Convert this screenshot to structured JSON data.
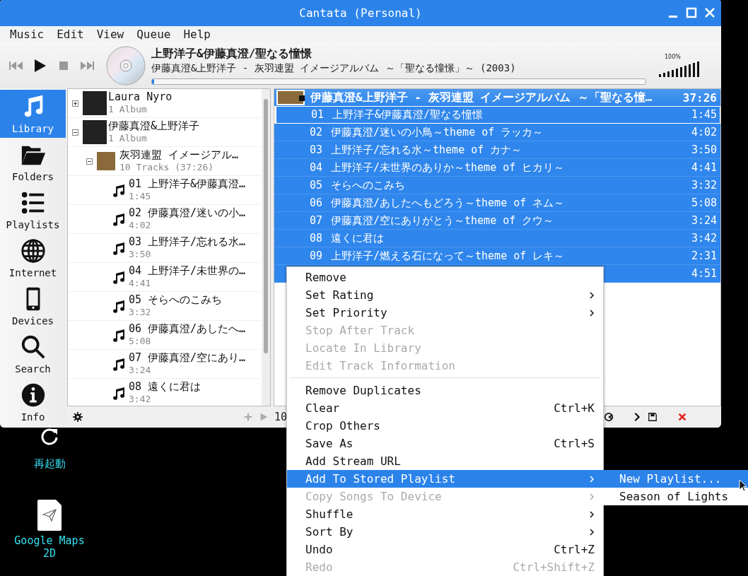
{
  "window": {
    "title": "Cantata (Personal)"
  },
  "menu_bar": [
    "Music",
    "Edit",
    "View",
    "Queue",
    "Help"
  ],
  "now_playing": {
    "title": "上野洋子&伊藤真澄/聖なる憧憬",
    "subtitle": "伊藤真澄&上野洋子 - 灰羽連盟 イメージアルバム ～「聖なる憧憬」～ (2003)",
    "level": 0.005
  },
  "volume": {
    "label": "100%",
    "level": 1
  },
  "sidebar": {
    "items": [
      {
        "label": "Library",
        "kind": "library",
        "selected": true
      },
      {
        "label": "Folders",
        "kind": "folders",
        "selected": false
      },
      {
        "label": "Playlists",
        "kind": "playlists",
        "selected": false
      },
      {
        "label": "Internet",
        "kind": "internet",
        "selected": false
      },
      {
        "label": "Devices",
        "kind": "devices",
        "selected": false
      },
      {
        "label": "Search",
        "kind": "search",
        "selected": false
      },
      {
        "label": "Info",
        "kind": "info",
        "selected": false
      }
    ]
  },
  "library": {
    "items": [
      {
        "kind": "artist",
        "title": "Laura Nyro",
        "detail": "1 Album",
        "expanded": false
      },
      {
        "kind": "artist",
        "title": "伊藤真澄&上野洋子",
        "detail": "1 Album",
        "expanded": true,
        "children": [
          {
            "kind": "album",
            "title": "灰羽連盟 イメージアル…",
            "detail": "10 Tracks (37:26)",
            "expanded": true,
            "children": [
              {
                "kind": "track",
                "title": "01 上野洋子&伊藤真澄…",
                "detail": "1:45"
              },
              {
                "kind": "track",
                "title": "02 伊藤真澄/迷いの小…",
                "detail": "4:02"
              },
              {
                "kind": "track",
                "title": "03 上野洋子/忘れる水…",
                "detail": "3:50"
              },
              {
                "kind": "track",
                "title": "04 上野洋子/未世界の…",
                "detail": "4:41"
              },
              {
                "kind": "track",
                "title": "05 そらへのこみち",
                "detail": "3:32"
              },
              {
                "kind": "track",
                "title": "06 伊藤真澄/あしたへ…",
                "detail": "5:08"
              },
              {
                "kind": "track",
                "title": "07 伊藤真澄/空にあり…",
                "detail": "3:24"
              },
              {
                "kind": "track",
                "title": "08 遠くに君は",
                "detail": "3:42"
              }
            ]
          }
        ]
      }
    ]
  },
  "playlist": {
    "header": {
      "title": "伊藤真澄&上野洋子 - 灰羽連盟 イメージアルバム ～「聖なる憧…",
      "duration": "37:26"
    },
    "rows": [
      {
        "number": "01",
        "title": "上野洋子&伊藤真澄/聖なる憧憬",
        "duration": "1:45",
        "selected": true,
        "current": true
      },
      {
        "number": "02",
        "title": "伊藤真澄/迷いの小鳥～theme of ラッカ～",
        "duration": "4:02",
        "selected": true,
        "current": false
      },
      {
        "number": "03",
        "title": "上野洋子/忘れる水～theme of カナ～",
        "duration": "3:50",
        "selected": true,
        "current": false
      },
      {
        "number": "04",
        "title": "上野洋子/未世界のありか～theme of ヒカリ～",
        "duration": "4:41",
        "selected": true,
        "current": false
      },
      {
        "number": "05",
        "title": "そらへのこみち",
        "duration": "3:32",
        "selected": true,
        "current": false
      },
      {
        "number": "06",
        "title": "伊藤真澄/あしたへもどろう～theme of ネム～",
        "duration": "5:08",
        "selected": true,
        "current": false
      },
      {
        "number": "07",
        "title": "伊藤真澄/空にありがとう～theme of クウ～",
        "duration": "3:24",
        "selected": true,
        "current": false
      },
      {
        "number": "08",
        "title": "遠くに君は",
        "duration": "3:42",
        "selected": true,
        "current": false
      },
      {
        "number": "09",
        "title": "上野洋子/燃える石になって～theme of レキ～",
        "duration": "2:31",
        "selected": true,
        "current": false
      },
      {
        "duration": "4:51",
        "selected": true,
        "current": false
      }
    ],
    "status": "10"
  },
  "context_menu": {
    "items": [
      {
        "kind": "item",
        "label": "Remove",
        "disabled": false,
        "submenu": false,
        "selected": false
      },
      {
        "kind": "item",
        "label": "Set Rating",
        "disabled": false,
        "submenu": true,
        "selected": false
      },
      {
        "kind": "item",
        "label": "Set Priority",
        "disabled": false,
        "submenu": true,
        "selected": false
      },
      {
        "kind": "item",
        "label": "Stop After Track",
        "disabled": true,
        "submenu": false,
        "selected": false
      },
      {
        "kind": "item",
        "label": "Locate In Library",
        "disabled": true,
        "submenu": false,
        "selected": false
      },
      {
        "kind": "item",
        "label": "Edit Track Information",
        "disabled": true,
        "submenu": false,
        "selected": false
      },
      {
        "kind": "separator"
      },
      {
        "kind": "item",
        "label": "Remove Duplicates",
        "disabled": false,
        "submenu": false,
        "selected": false
      },
      {
        "kind": "item",
        "label": "Clear",
        "shortcut": "Ctrl+K",
        "disabled": false,
        "submenu": false,
        "selected": false
      },
      {
        "kind": "item",
        "label": "Crop Others",
        "disabled": false,
        "submenu": false,
        "selected": false
      },
      {
        "kind": "item",
        "label": "Save As",
        "shortcut": "Ctrl+S",
        "disabled": false,
        "submenu": false,
        "selected": false
      },
      {
        "kind": "item",
        "label": "Add Stream URL",
        "disabled": false,
        "submenu": false,
        "selected": false
      },
      {
        "kind": "item",
        "label": "Add To Stored Playlist",
        "disabled": false,
        "submenu": true,
        "selected": true
      },
      {
        "kind": "item",
        "label": "Copy Songs To Device",
        "disabled": true,
        "submenu": true,
        "selected": false
      },
      {
        "kind": "item",
        "label": "Shuffle",
        "disabled": false,
        "submenu": true,
        "selected": false
      },
      {
        "kind": "item",
        "label": "Sort By",
        "disabled": false,
        "submenu": true,
        "selected": false
      },
      {
        "kind": "item",
        "label": "Undo",
        "shortcut": "Ctrl+Z",
        "disabled": false,
        "submenu": false,
        "selected": false
      },
      {
        "kind": "item",
        "label": "Redo",
        "shortcut": "Ctrl+Shift+Z",
        "disabled": true,
        "submenu": false,
        "selected": false
      }
    ]
  },
  "submenu": {
    "items": [
      {
        "label": "New Playlist...",
        "selected": true
      },
      {
        "label": "Season of Lights",
        "selected": false
      }
    ]
  },
  "desktop": {
    "icons": [
      {
        "label": "再起動",
        "kind": "restart"
      },
      {
        "label": "Google Maps 2D",
        "kind": "file"
      }
    ]
  }
}
